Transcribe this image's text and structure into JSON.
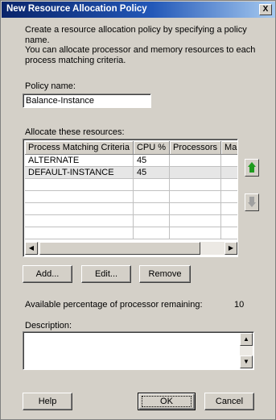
{
  "dialog": {
    "title": "New Resource Allocation Policy",
    "close_glyph": "X",
    "intro": "Create a resource allocation policy by specifying a policy name.\nYou can allocate processor and memory resources to each\nprocess matching criteria."
  },
  "policy": {
    "label": "Policy name:",
    "value": "Balance-Instance"
  },
  "resources": {
    "label": "Allocate these resources:",
    "columns": [
      "Process Matching Criteria",
      "CPU %",
      "Processors",
      "Ma"
    ],
    "rows": [
      [
        "ALTERNATE",
        "45",
        "",
        ""
      ],
      [
        "DEFAULT-INSTANCE",
        "45",
        "",
        ""
      ],
      [
        "",
        "",
        "",
        ""
      ],
      [
        "",
        "",
        "",
        ""
      ],
      [
        "",
        "",
        "",
        ""
      ],
      [
        "",
        "",
        "",
        ""
      ],
      [
        "",
        "",
        "",
        ""
      ]
    ],
    "selected_row": 1
  },
  "buttons": {
    "add": "Add...",
    "edit": "Edit...",
    "remove": "Remove",
    "help": "Help",
    "ok": "OK",
    "cancel": "Cancel"
  },
  "available": {
    "label": "Available percentage of processor remaining:",
    "value": "10"
  },
  "description": {
    "label": "Description:",
    "value": ""
  },
  "icons": {
    "move_up": "arrow-up-icon",
    "move_down": "arrow-down-icon"
  },
  "colors": {
    "titlebar_start": "#0a246a",
    "titlebar_end": "#a6caf0",
    "face": "#d4d0c8",
    "move_up_arrow": "#1e9b1e"
  }
}
